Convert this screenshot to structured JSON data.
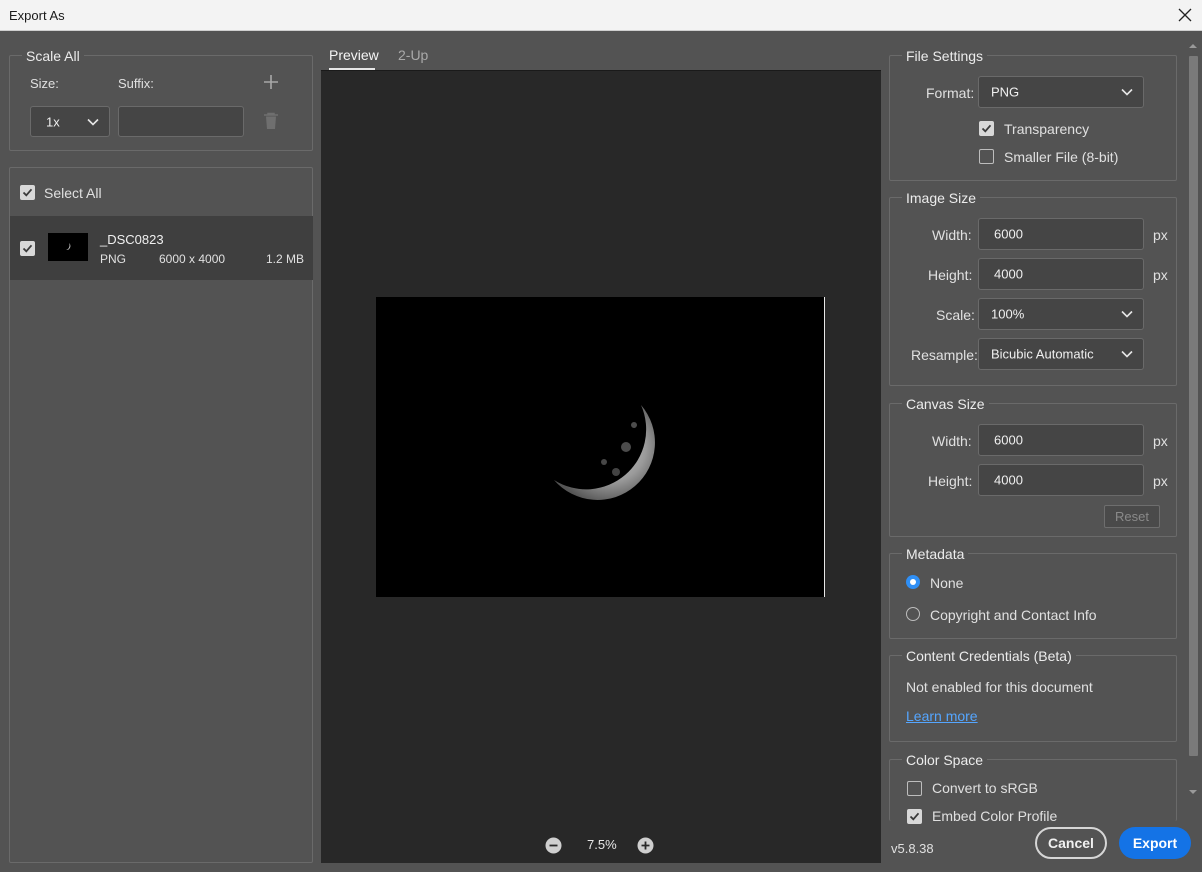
{
  "window": {
    "title": "Export As"
  },
  "scale_all": {
    "legend": "Scale All",
    "size_label": "Size:",
    "suffix_label": "Suffix:",
    "size_value": "1x",
    "suffix_value": ""
  },
  "file_list": {
    "select_all_label": "Select All",
    "items": [
      {
        "name": "_DSC0823",
        "format": "PNG",
        "dimensions": "6000 x 4000",
        "size": "1.2 MB"
      }
    ]
  },
  "tabs": [
    {
      "label": "Preview"
    },
    {
      "label": "2-Up"
    }
  ],
  "zoom": {
    "value": "7.5%"
  },
  "file_settings": {
    "legend": "File Settings",
    "format_label": "Format:",
    "format_value": "PNG",
    "transparency_label": "Transparency",
    "transparency_checked": true,
    "smaller_file_label": "Smaller File (8-bit)",
    "smaller_file_checked": false
  },
  "image_size": {
    "legend": "Image Size",
    "width_label": "Width:",
    "width_value": "6000",
    "height_label": "Height:",
    "height_value": "4000",
    "unit": "px",
    "scale_label": "Scale:",
    "scale_value": "100%",
    "resample_label": "Resample:",
    "resample_value": "Bicubic Automatic"
  },
  "canvas_size": {
    "legend": "Canvas Size",
    "width_label": "Width:",
    "width_value": "6000",
    "height_label": "Height:",
    "height_value": "4000",
    "unit": "px",
    "reset_label": "Reset"
  },
  "metadata": {
    "legend": "Metadata",
    "options": [
      {
        "label": "None",
        "selected": true
      },
      {
        "label": "Copyright and Contact Info",
        "selected": false
      }
    ]
  },
  "content_credentials": {
    "legend": "Content Credentials (Beta)",
    "status": "Not enabled for this document",
    "learn_more": "Learn more"
  },
  "color_space": {
    "legend": "Color Space",
    "convert_label": "Convert to sRGB",
    "convert_checked": false,
    "embed_label": "Embed Color Profile",
    "embed_checked": true
  },
  "footer": {
    "version": "v5.8.38",
    "cancel_label": "Cancel",
    "export_label": "Export"
  },
  "colors": {
    "accent": "#1473e6",
    "radio": "#2f8ff5",
    "link": "#55a6ff",
    "panel_bg": "#535353",
    "preview_bg": "#282828"
  }
}
